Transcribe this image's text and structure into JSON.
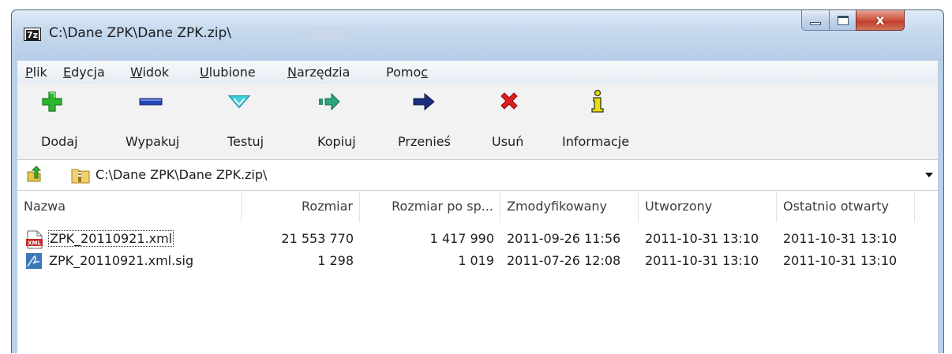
{
  "window": {
    "title": "C:\\Dane ZPK\\Dane ZPK.zip\\",
    "app_icon_text": "7z",
    "controls": {
      "minimize_icon": "minimize-icon",
      "maximize_icon": "maximize-icon",
      "close_icon": "close-icon",
      "close_glyph": "x"
    }
  },
  "menu": {
    "items": [
      {
        "label": "Plik",
        "accel_index": 0
      },
      {
        "label": "Edycja",
        "accel_index": 0
      },
      {
        "label": "Widok",
        "accel_index": 0
      },
      {
        "label": "Ulubione",
        "accel_index": 0
      },
      {
        "label": "Narzędzia",
        "accel_index": 0
      },
      {
        "label": "Pomoc",
        "accel_index": 4
      }
    ]
  },
  "toolbar": {
    "buttons": [
      {
        "label": "Dodaj",
        "icon": "plus-icon"
      },
      {
        "label": "Wypakuj",
        "icon": "minus-icon"
      },
      {
        "label": "Testuj",
        "icon": "check-icon"
      },
      {
        "label": "Kopiuj",
        "icon": "copy-arrow-icon"
      },
      {
        "label": "Przenieś",
        "icon": "move-arrow-icon"
      },
      {
        "label": "Usuń",
        "icon": "delete-x-icon"
      },
      {
        "label": "Informacje",
        "icon": "info-icon"
      }
    ]
  },
  "address": {
    "path": "C:\\Dane ZPK\\Dane ZPK.zip\\",
    "up_icon": "up-folder-icon",
    "folder_icon": "zip-folder-icon"
  },
  "list": {
    "columns": [
      "Nazwa",
      "Rozmiar",
      "Rozmiar po sp...",
      "Zmodyfikowany",
      "Utworzony",
      "Ostatnio otwarty"
    ],
    "rows": [
      {
        "name": "ZPK_20110921.xml",
        "size": "21 553 770",
        "packed": "1 417 990",
        "modified": "2011-09-26 11:56",
        "created": "2011-10-31 13:10",
        "accessed": "2011-10-31 13:10",
        "icon": "xml-file-icon",
        "focused": true
      },
      {
        "name": "ZPK_20110921.xml.sig",
        "size": "1 298",
        "packed": "1 019",
        "modified": "2011-07-26 12:08",
        "created": "2011-10-31 13:10",
        "accessed": "2011-10-31 13:10",
        "icon": "signature-file-icon",
        "focused": false
      }
    ]
  },
  "colors": {
    "title_gradient_top": "#dfeaf6",
    "close_button": "#c0402a",
    "toolbar_bg": "#f2f2f2",
    "add_green": "#1fa41f",
    "extract_blue": "#1f3fa8",
    "test_cyan": "#39c8d6",
    "delete_red": "#d81c1c"
  }
}
